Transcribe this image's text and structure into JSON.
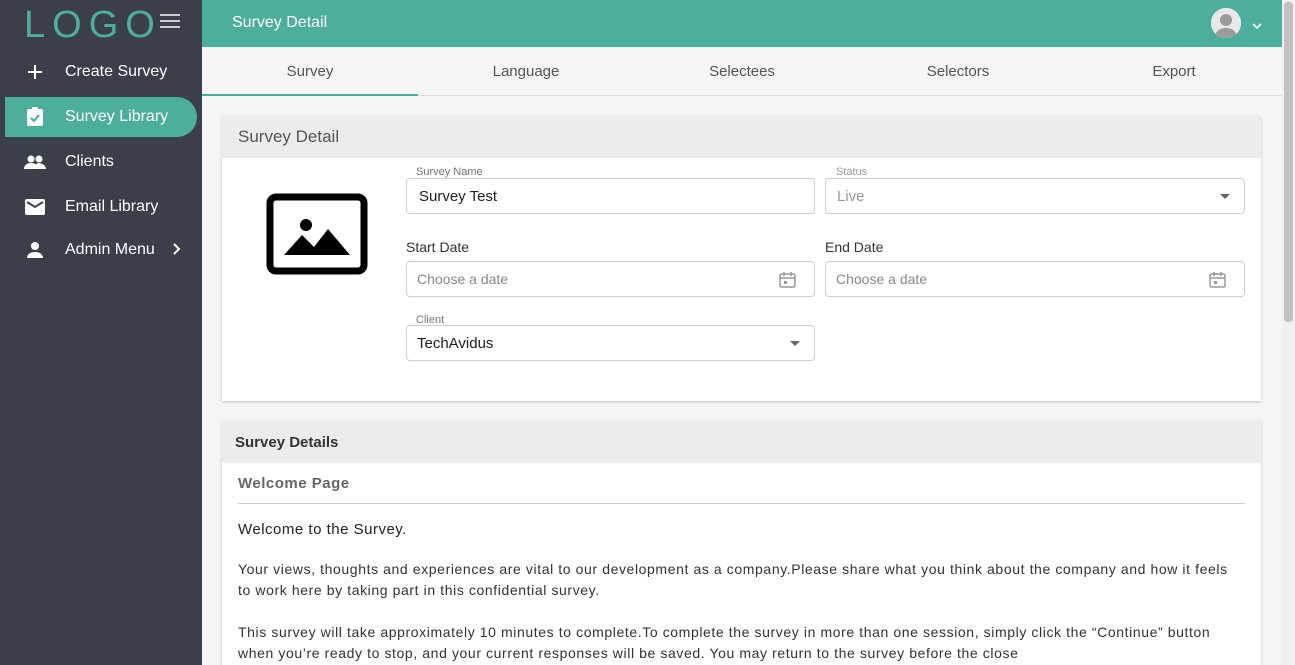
{
  "sidebar": {
    "logo": "LOGO",
    "items": [
      {
        "label": "Create Survey",
        "icon": "plus-icon"
      },
      {
        "label": "Survey Library",
        "icon": "clipboard-check-icon",
        "active": true
      },
      {
        "label": "Clients",
        "icon": "people-icon"
      },
      {
        "label": "Email Library",
        "icon": "mail-icon"
      },
      {
        "label": "Admin Menu",
        "icon": "person-icon"
      }
    ]
  },
  "header": {
    "title": "Survey Detail"
  },
  "tabs": [
    {
      "label": "Survey",
      "active": true
    },
    {
      "label": "Language"
    },
    {
      "label": "Selectees"
    },
    {
      "label": "Selectors"
    },
    {
      "label": "Export"
    }
  ],
  "detail_card": {
    "title": "Survey Detail",
    "survey_name": {
      "label": "Survey Name",
      "value": "Survey Test"
    },
    "status": {
      "label": "Status",
      "value": "Live"
    },
    "start_date": {
      "label": "Start Date",
      "placeholder": "Choose a date"
    },
    "end_date": {
      "label": "End Date",
      "placeholder": "Choose a date"
    },
    "client": {
      "label": "Client",
      "value": "TechAvidus"
    }
  },
  "details_card": {
    "title": "Survey Details",
    "welcome_label": "Welcome Page",
    "welcome_heading": "Welcome to the Survey.",
    "paragraph1": "Your views, thoughts and experiences are vital to our development as a company.Please share what you think about the company and how it feels to work here by taking part in this confidential survey.",
    "paragraph2": "This survey will take approximately 10 minutes to complete.To complete the survey in more than one session, simply click the “Continue” button when you’re ready to stop, and your current responses will be saved. You may return to the survey before the close"
  },
  "colors": {
    "accent": "#4caf9c",
    "sidebar": "#3a3f4a"
  }
}
